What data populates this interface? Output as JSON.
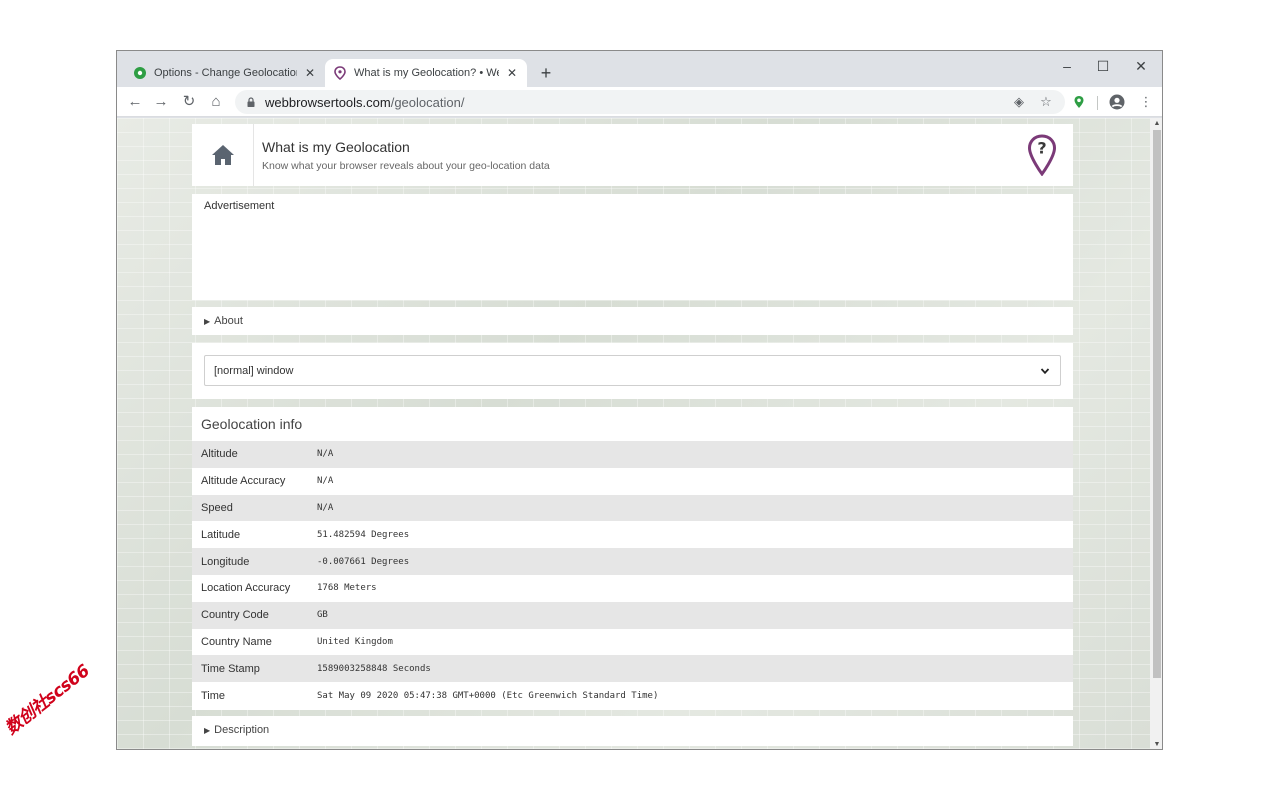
{
  "browser": {
    "tabs": [
      {
        "title": "Options - Change Geolocation",
        "active": false,
        "favicon": "green-pin-icon"
      },
      {
        "title": "What is my Geolocation? • WebB",
        "active": true,
        "favicon": "purple-pin-icon"
      }
    ],
    "url_domain": "webbrowsertools.com",
    "url_path": "/geolocation/"
  },
  "header": {
    "title": "What is my Geolocation",
    "subtitle": "Know what your browser reveals about your geo-location data"
  },
  "ad": {
    "label": "Advertisement"
  },
  "about": {
    "label": "About"
  },
  "window_select": {
    "selected": "[normal] window"
  },
  "geolocation": {
    "title": "Geolocation info",
    "rows": [
      {
        "label": "Altitude",
        "value": "N/A"
      },
      {
        "label": "Altitude Accuracy",
        "value": "N/A"
      },
      {
        "label": "Speed",
        "value": "N/A"
      },
      {
        "label": "Latitude",
        "value": "51.482594 Degrees"
      },
      {
        "label": "Longitude",
        "value": "-0.007661 Degrees"
      },
      {
        "label": "Location Accuracy",
        "value": "1768 Meters"
      },
      {
        "label": "Country Code",
        "value": "GB"
      },
      {
        "label": "Country Name",
        "value": "United Kingdom"
      },
      {
        "label": "Time Stamp",
        "value": "1589003258848 Seconds"
      },
      {
        "label": "Time",
        "value": "Sat May 09 2020 05:47:38 GMT+0000 (Etc Greenwich Standard Time)"
      }
    ]
  },
  "description": {
    "label": "Description"
  },
  "watermark": {
    "text": "数创社scs66"
  },
  "colors": {
    "accent": "#7b3a78",
    "home": "#5a6470",
    "extension": "#2e9e44"
  }
}
